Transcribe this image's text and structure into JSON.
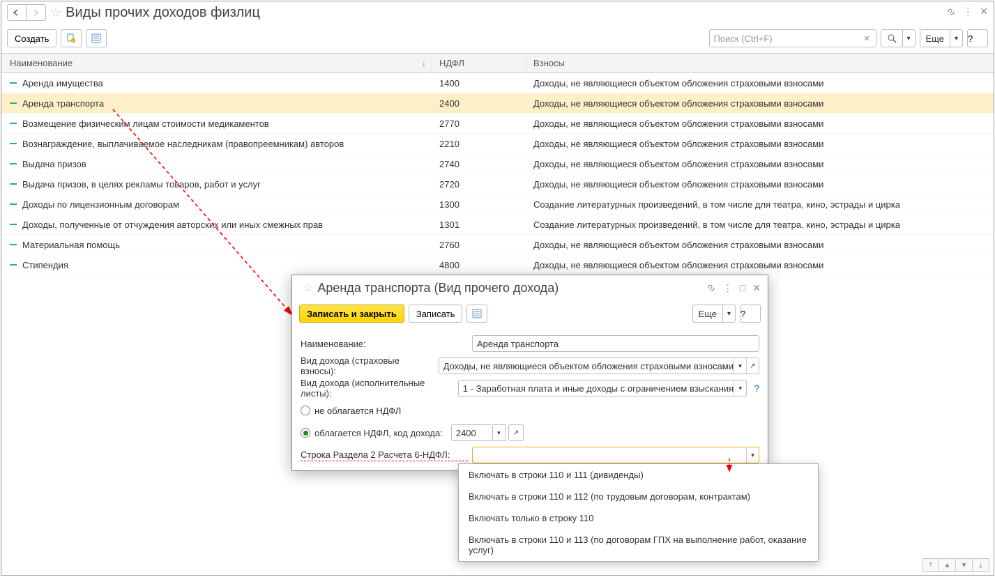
{
  "header": {
    "title": "Виды прочих доходов физлиц"
  },
  "toolbar": {
    "create": "Создать",
    "search_placeholder": "Поиск (Ctrl+F)",
    "more": "Еще",
    "help": "?"
  },
  "columns": {
    "name": "Наименование",
    "ndfl": "НДФЛ",
    "fees": "Взносы"
  },
  "rows": [
    {
      "name": "Аренда имущества",
      "ndfl": "1400",
      "fees": "Доходы, не являющиеся объектом обложения страховыми взносами"
    },
    {
      "name": "Аренда транспорта",
      "ndfl": "2400",
      "fees": "Доходы, не являющиеся объектом обложения страховыми взносами",
      "selected": true
    },
    {
      "name": "Возмещение физическим лицам стоимости медикаментов",
      "ndfl": "2770",
      "fees": "Доходы, не являющиеся объектом обложения страховыми взносами"
    },
    {
      "name": "Вознаграждение, выплачиваемое наследникам (правопреемникам) авторов",
      "ndfl": "2210",
      "fees": "Доходы, не являющиеся объектом обложения страховыми взносами"
    },
    {
      "name": "Выдача призов",
      "ndfl": "2740",
      "fees": "Доходы, не являющиеся объектом обложения страховыми взносами"
    },
    {
      "name": "Выдача призов, в целях рекламы товаров, работ и услуг",
      "ndfl": "2720",
      "fees": "Доходы, не являющиеся объектом обложения страховыми взносами"
    },
    {
      "name": "Доходы по лицензионным договорам",
      "ndfl": "1300",
      "fees": "Создание литературных произведений, в том числе для театра, кино, эстрады и цирка"
    },
    {
      "name": "Доходы, полученные от отчуждения авторских или иных смежных прав",
      "ndfl": "1301",
      "fees": "Создание литературных произведений, в том числе для театра, кино, эстрады и цирка"
    },
    {
      "name": "Материальная помощь",
      "ndfl": "2760",
      "fees": "Доходы, не являющиеся объектом обложения страховыми взносами"
    },
    {
      "name": "Стипендия",
      "ndfl": "4800",
      "fees": "Доходы, не являющиеся объектом обложения страховыми взносами"
    }
  ],
  "popup": {
    "title": "Аренда транспорта (Вид прочего дохода)",
    "save_close": "Записать и закрыть",
    "save": "Записать",
    "more": "Еще",
    "help": "?",
    "labels": {
      "name": "Наименование:",
      "insur": "Вид дохода (страховые взносы):",
      "exec": "Вид дохода (исполнительные листы):",
      "not_taxed": "не облагается НДФЛ",
      "taxed": "облагается НДФЛ, код дохода:",
      "line6": "Строка Раздела 2 Расчета 6-НДФЛ:"
    },
    "values": {
      "name": "Аренда транспорта",
      "insur": "Доходы, не являющиеся объектом обложения страховыми взносами",
      "exec": "1 - Заработная плата и иные доходы с ограничением взыскания",
      "code": "2400"
    }
  },
  "dropdown": {
    "options": [
      "Включать в строки 110 и 111 (дивиденды)",
      "Включать в строки 110 и 112 (по трудовым договорам, контрактам)",
      "Включать только в строку 110",
      "Включать в строки 110 и 113 (по договорам ГПХ на выполнение работ, оказание услуг)"
    ]
  }
}
